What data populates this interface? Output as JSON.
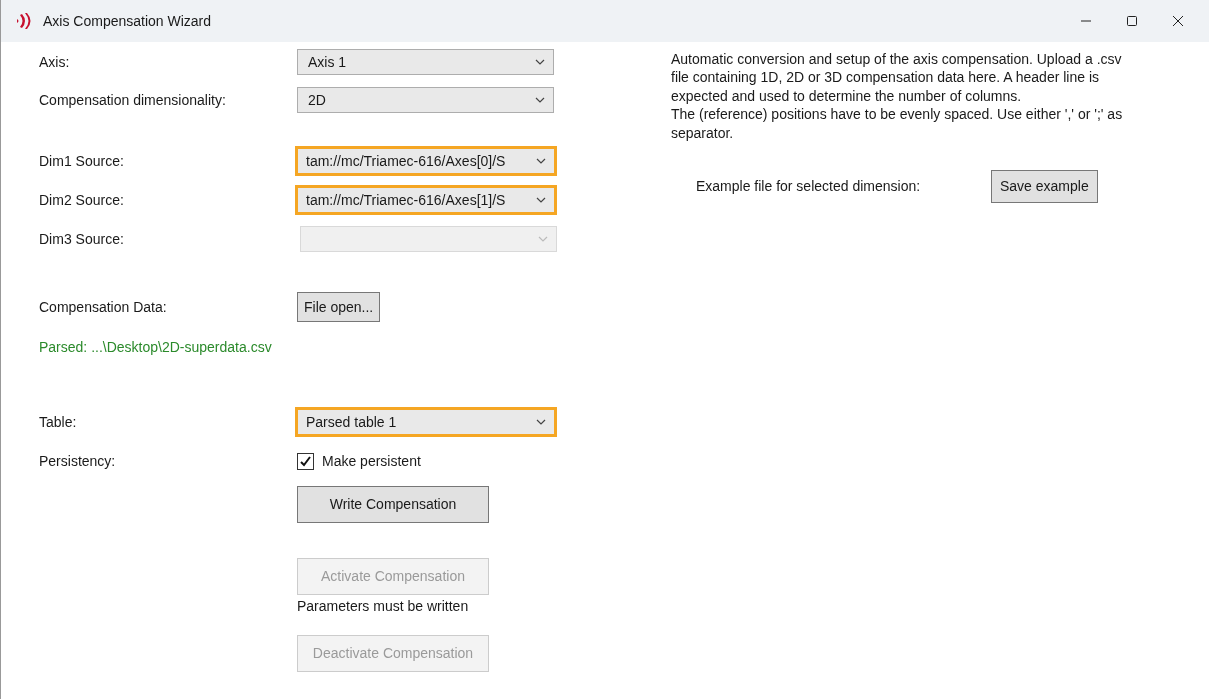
{
  "window": {
    "title": "Axis Compensation Wizard"
  },
  "form": [
    {
      "kind": "select",
      "label": "Axis:",
      "value": "Axis 1",
      "highlighted": false,
      "disabled": false
    },
    {
      "kind": "select",
      "label": "Compensation dimensionality:",
      "value": "2D",
      "highlighted": false,
      "disabled": false
    },
    {
      "kind": "select",
      "label": "Dim1 Source:",
      "value": "tam://mc/Triamec-616/Axes[0]/S",
      "highlighted": true,
      "disabled": false
    },
    {
      "kind": "select",
      "label": "Dim2 Source:",
      "value": "tam://mc/Triamec-616/Axes[1]/S",
      "highlighted": true,
      "disabled": false
    },
    {
      "kind": "select",
      "label": "Dim3 Source:",
      "highlighted": false,
      "disabled": true
    },
    {
      "kind": "button",
      "label": "Compensation Data:",
      "text": "File open...",
      "disabled": false
    },
    {
      "kind": "status",
      "text": "Parsed: ...\\Desktop\\2D-superdata.csv"
    },
    {
      "kind": "select",
      "label": "Table:",
      "value": "Parsed table 1",
      "highlighted": true,
      "disabled": false
    },
    {
      "kind": "checkbox",
      "label": "Persistency:",
      "text": "Make persistent",
      "checked": true
    },
    {
      "kind": "button",
      "text": "Write Compensation",
      "disabled": false
    },
    {
      "kind": "button",
      "text": "Activate Compensation",
      "disabled": true
    },
    {
      "kind": "note",
      "text": "Parameters must be written"
    },
    {
      "kind": "button",
      "text": "Deactivate Compensation",
      "disabled": true
    }
  ],
  "description": [
    "Automatic conversion and setup of the axis compensation. Upload a .csv file containing 1D, 2D or 3D compensation data here. A header line is expected and used to determine the number of columns.",
    "The (reference) positions have to be evenly spaced. Use either ',' or ';' as separator."
  ],
  "example": {
    "label": "Example file for selected dimension:",
    "button": "Save example"
  }
}
